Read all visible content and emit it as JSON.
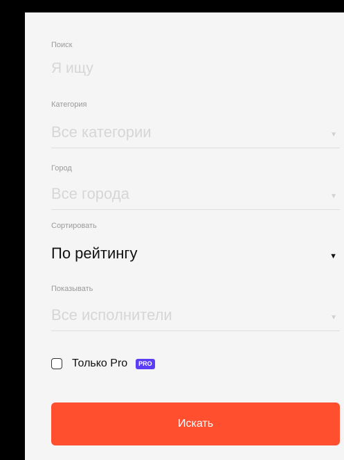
{
  "search": {
    "label": "Поиск",
    "placeholder": "Я ищу"
  },
  "category": {
    "label": "Категория",
    "value": "Все категории"
  },
  "city": {
    "label": "Город",
    "value": "Все города"
  },
  "sort": {
    "label": "Сортировать",
    "value": "По рейтингу"
  },
  "show": {
    "label": "Показывать",
    "value": "Все исполнители"
  },
  "pro_only": {
    "label": "Только Pro",
    "badge": "PRO",
    "checked": false
  },
  "submit": {
    "label": "Искать"
  },
  "colors": {
    "accent": "#ff4f2f",
    "badge": "#5b3df5",
    "panel": "#f5f5f5"
  }
}
